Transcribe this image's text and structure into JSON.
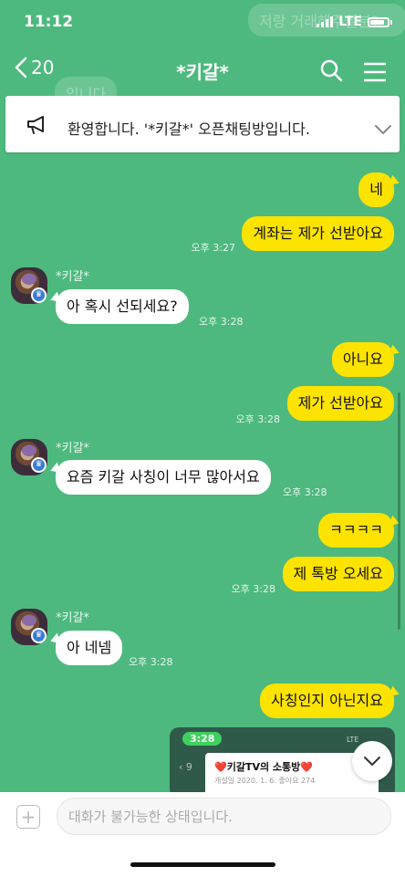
{
  "status_bar": {
    "time": "11:12",
    "network": "LTE"
  },
  "background_ghost": {
    "top_right": "저랑 거래해주실분?",
    "left": "입니다"
  },
  "header": {
    "back_count": "20",
    "title": "*키갈*"
  },
  "notice": {
    "text": "환영합니다. '*키갈*' 오픈채팅방입니다."
  },
  "messages": [
    {
      "side": "mine",
      "text": "네"
    },
    {
      "side": "mine",
      "text": "계좌는 제가 선받아요",
      "time": "오후 3:27"
    },
    {
      "side": "theirs",
      "sender": "*키갈*",
      "text": "아 혹시 선되세요?",
      "time": "오후 3:28"
    },
    {
      "side": "mine",
      "text": "아니요"
    },
    {
      "side": "mine",
      "text": "제가 선받아요",
      "time": "오후 3:28"
    },
    {
      "side": "theirs",
      "sender": "*키갈*",
      "text": "요즘 키갈 사칭이 너무 많아서요",
      "time": "오후 3:28"
    },
    {
      "side": "mine",
      "text": "ㅋㅋㅋㅋ"
    },
    {
      "side": "mine",
      "text": "제 톡방 오세요",
      "time": "오후 3:28"
    },
    {
      "side": "theirs",
      "sender": "*키갈*",
      "text": "아 네넴",
      "time": "오후 3:28"
    },
    {
      "side": "mine",
      "text": "사칭인지 아닌지요"
    }
  ],
  "shared_image": {
    "status_time": "3:28",
    "status_right": "LTE",
    "back_count": "9",
    "card_title": "❤️키갈TV의 소통방❤️",
    "card_sub": "개설일 2020. 1. 6.   좋아요 274"
  },
  "input": {
    "placeholder": "대화가 불가능한 상태입니다."
  },
  "icons": {
    "back": "chevron-left-icon",
    "search": "search-icon",
    "menu": "hamburger-menu-icon",
    "notice": "megaphone-icon",
    "notice_toggle": "chevron-down-icon",
    "scroll_down": "chevron-down-icon",
    "plus": "plus-icon",
    "badge": "crown-icon"
  },
  "colors": {
    "background": "#4db97e",
    "my_bubble": "#fde300",
    "their_bubble": "#ffffff"
  }
}
